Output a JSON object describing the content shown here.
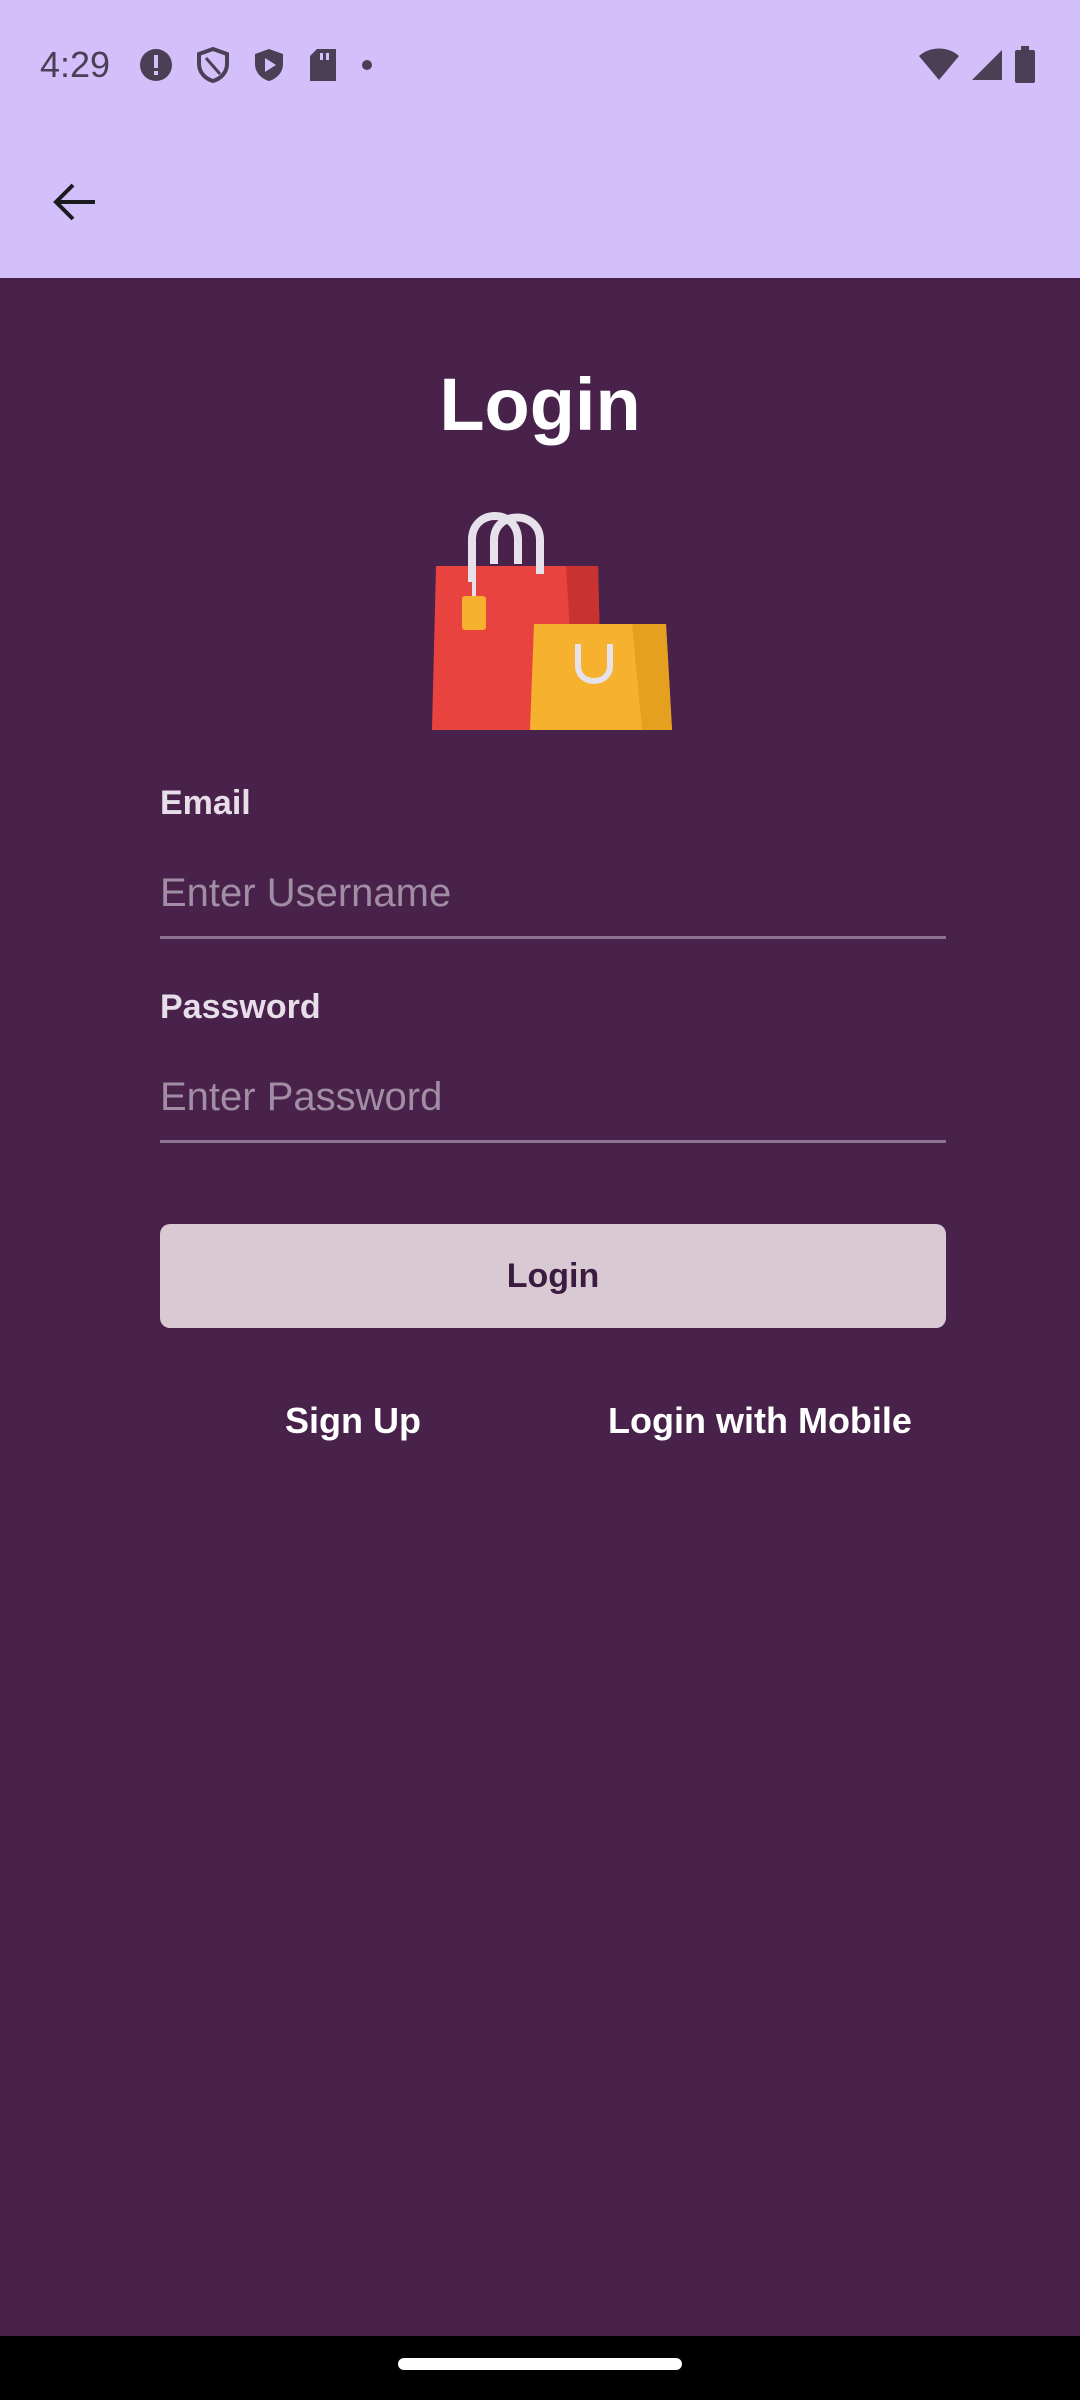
{
  "status_bar": {
    "time": "4:29",
    "left_icons": [
      "alert-icon",
      "shield-outline-icon",
      "shield-play-icon",
      "sd-card-icon",
      "dot-icon"
    ],
    "right_icons": [
      "wifi-icon",
      "signal-icon",
      "battery-icon"
    ]
  },
  "app_bar": {
    "back_icon": "arrow-back-icon"
  },
  "page": {
    "title": "Login",
    "logo_icon": "shopping-bags-icon",
    "email": {
      "label": "Email",
      "placeholder": "Enter Username",
      "value": ""
    },
    "password": {
      "label": "Password",
      "placeholder": "Enter Password",
      "value": ""
    },
    "login_button": "Login",
    "signup_link": "Sign Up",
    "mobile_login_link": "Login with Mobile"
  },
  "colors": {
    "app_bar_bg": "#D3BFFA",
    "page_bg": "#48224A",
    "button_bg": "#D8C9D2",
    "button_text": "#3B1B3F",
    "bag_red": "#E9433F",
    "bag_yellow": "#F6B12E"
  }
}
